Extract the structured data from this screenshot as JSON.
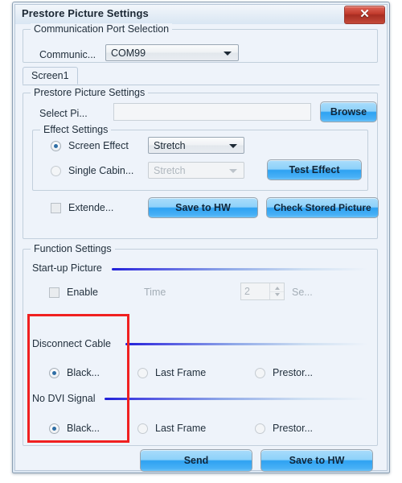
{
  "window": {
    "title": "Prestore Picture Settings",
    "close_label": "✕"
  },
  "comm_group": {
    "title": "Communication Port Selection",
    "label": "Communic...",
    "port_value": "COM99"
  },
  "tabs": [
    {
      "label": "Screen1",
      "selected": true
    }
  ],
  "prestore_group": {
    "title": "Prestore Picture Settings",
    "select_label": "Select Pi...",
    "path_value": "",
    "path_placeholder": "",
    "browse_label": "Browse"
  },
  "effect_group": {
    "title": "Effect Settings",
    "screen_effect_label": "Screen Effect",
    "screen_effect_value": "Stretch",
    "screen_effect_selected": true,
    "single_cabinet_label": "Single Cabin...",
    "single_cabinet_value": "Stretch",
    "single_cabinet_selected": false,
    "test_effect_label": "Test Effect"
  },
  "extend_row": {
    "extend_label": "Extende...",
    "extend_checked": false,
    "save_to_hw_label": "Save to HW",
    "check_stored_label": "Check Stored Picture"
  },
  "function_group": {
    "title": "Function Settings",
    "startup": {
      "section_label": "Start-up Picture",
      "enable_label": "Enable",
      "enable_checked": false,
      "time_label": "Time",
      "time_value": "2",
      "unit_label": "Se..."
    },
    "disconnect_cable": {
      "section_label": "Disconnect Cable",
      "options": [
        {
          "label": "Black...",
          "selected": true
        },
        {
          "label": "Last Frame",
          "selected": false
        },
        {
          "label": "Prestor...",
          "selected": false
        }
      ]
    },
    "no_dvi_signal": {
      "section_label": "No DVI Signal",
      "options": [
        {
          "label": "Black...",
          "selected": true
        },
        {
          "label": "Last Frame",
          "selected": false
        },
        {
          "label": "Prestor...",
          "selected": false
        }
      ]
    }
  },
  "footer": {
    "send_label": "Send",
    "save_to_hw_label": "Save to HW"
  },
  "annotation": {
    "highlight_color": "#f02020"
  }
}
